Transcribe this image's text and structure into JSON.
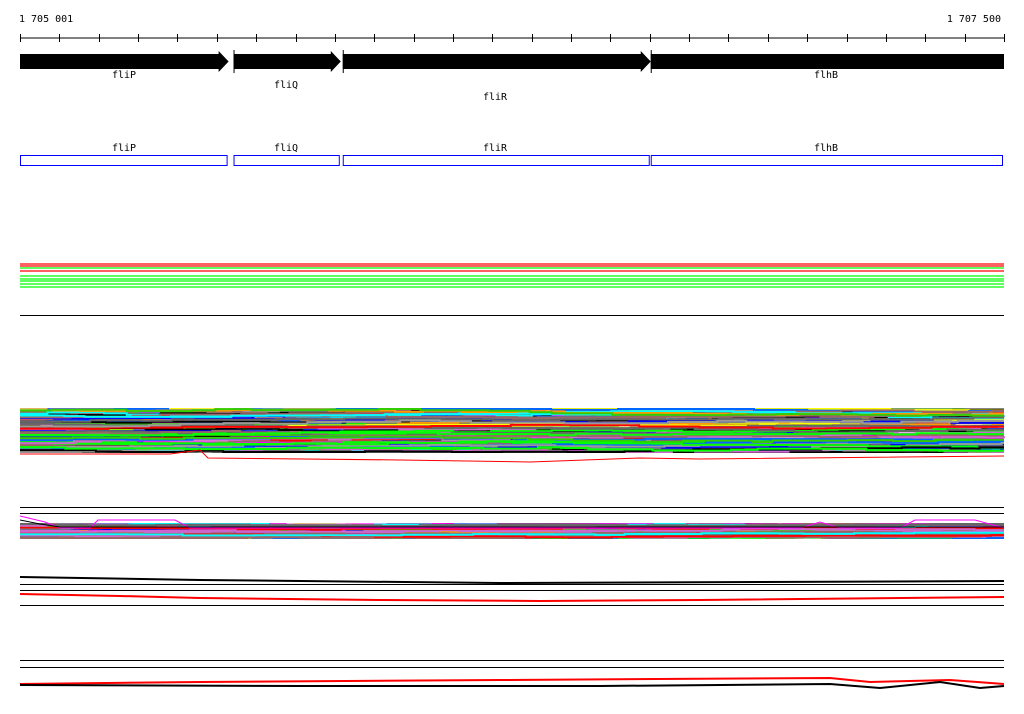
{
  "ruler": {
    "start_label": "1 705 001",
    "end_label": "1 707 500",
    "start": 1705001,
    "end": 1707500
  },
  "genes": [
    {
      "name": "fliP",
      "from": 0.0,
      "to": 0.212
    },
    {
      "name": "fliQ",
      "from": 0.217,
      "to": 0.326
    },
    {
      "name": "fliR",
      "from": 0.328,
      "to": 0.641
    },
    {
      "name": "flhB",
      "from": 0.641,
      "to": 1.0
    }
  ],
  "colors": {
    "gene_arrow": "#000000",
    "cds_box": "#0000ff"
  }
}
